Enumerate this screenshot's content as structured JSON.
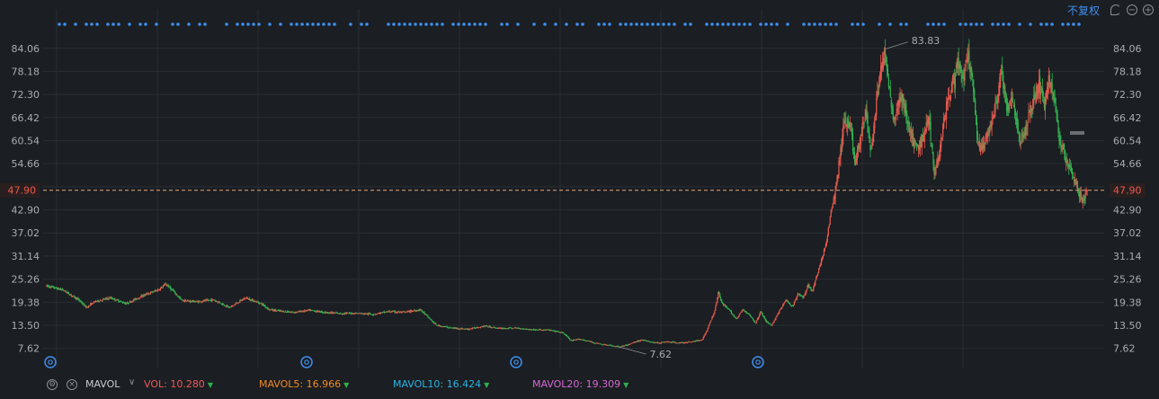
{
  "toolbar": {
    "adjust_mode": "不复权"
  },
  "chart_data": {
    "type": "candlestick",
    "y_ticks": [
      "84.06",
      "78.18",
      "72.30",
      "66.42",
      "60.54",
      "54.66",
      "48.78",
      "42.90",
      "37.02",
      "31.14",
      "25.26",
      "19.38",
      "13.50",
      "7.62"
    ],
    "ylim": [
      2.5,
      89.5
    ],
    "last_price": "47.90",
    "max_label": "83.83",
    "min_label": "7.62",
    "grid": true,
    "price_path": [
      [
        0,
        23.5
      ],
      [
        2,
        22.5
      ],
      [
        4,
        20.0
      ],
      [
        5,
        18.0
      ],
      [
        6,
        19.5
      ],
      [
        8,
        20.5
      ],
      [
        10,
        19.0
      ],
      [
        12,
        21.0
      ],
      [
        14,
        22.5
      ],
      [
        15,
        24.0
      ],
      [
        16,
        22.0
      ],
      [
        17,
        19.8
      ],
      [
        19,
        19.5
      ],
      [
        21,
        20.0
      ],
      [
        23,
        18.0
      ],
      [
        25,
        20.5
      ],
      [
        27,
        19.0
      ],
      [
        28,
        17.5
      ],
      [
        29,
        17.2
      ],
      [
        31,
        16.8
      ],
      [
        33,
        17.3
      ],
      [
        35,
        16.8
      ],
      [
        37,
        16.5
      ],
      [
        39,
        16.6
      ],
      [
        41,
        16.3
      ],
      [
        43,
        17.0
      ],
      [
        45,
        16.8
      ],
      [
        47,
        17.5
      ],
      [
        48,
        15.5
      ],
      [
        49,
        13.5
      ],
      [
        51,
        12.8
      ],
      [
        53,
        12.5
      ],
      [
        55,
        13.3
      ],
      [
        57,
        12.7
      ],
      [
        59,
        12.8
      ],
      [
        61,
        12.4
      ],
      [
        63,
        12.3
      ],
      [
        64,
        12.0
      ],
      [
        65,
        11.5
      ],
      [
        66,
        9.5
      ],
      [
        67,
        10.0
      ],
      [
        68,
        9.5
      ],
      [
        69,
        9.0
      ],
      [
        70,
        8.6
      ],
      [
        71,
        8.3
      ],
      [
        72,
        8.0
      ],
      [
        73,
        8.4
      ],
      [
        74,
        9.3
      ],
      [
        75,
        9.8
      ],
      [
        76,
        9.2
      ],
      [
        77,
        9.0
      ],
      [
        78,
        9.3
      ],
      [
        79,
        9.1
      ],
      [
        80,
        9.0
      ],
      [
        81,
        9.3
      ],
      [
        82,
        9.6
      ],
      [
        82.5,
        10.0
      ],
      [
        83,
        12.0
      ],
      [
        83.5,
        14.5
      ],
      [
        84,
        17.0
      ],
      [
        84.5,
        22.0
      ],
      [
        85,
        19.0
      ],
      [
        86,
        17.0
      ],
      [
        86.8,
        15.0
      ],
      [
        87.5,
        17.5
      ],
      [
        88.5,
        16.0
      ],
      [
        89.2,
        14.0
      ],
      [
        89.8,
        17.0
      ],
      [
        90.5,
        14.5
      ],
      [
        91.2,
        13.5
      ],
      [
        92,
        16.5
      ],
      [
        93,
        20.0
      ],
      [
        93.8,
        18.0
      ],
      [
        94.5,
        21.5
      ],
      [
        95.2,
        20.5
      ],
      [
        95.8,
        24.0
      ],
      [
        96.3,
        22.0
      ],
      [
        97,
        27.0
      ],
      [
        97.6,
        31.0
      ],
      [
        98.2,
        36.0
      ],
      [
        98.7,
        43.0
      ],
      [
        99.2,
        47.0
      ],
      [
        99.7,
        55.0
      ],
      [
        100.4,
        66.0
      ],
      [
        101.2,
        64.0
      ],
      [
        101.6,
        55.0
      ],
      [
        102.3,
        60.0
      ],
      [
        103,
        68.0
      ],
      [
        103.7,
        58.0
      ],
      [
        104.2,
        66.0
      ],
      [
        104.8,
        78.0
      ],
      [
        105.4,
        82.0
      ],
      [
        106,
        75.0
      ],
      [
        106.5,
        66.0
      ],
      [
        107,
        69.0
      ],
      [
        107.6,
        72.0
      ],
      [
        108.3,
        65.0
      ],
      [
        109,
        60.0
      ],
      [
        109.6,
        58.0
      ],
      [
        110.3,
        62.0
      ],
      [
        111,
        66.0
      ],
      [
        111.7,
        52.0
      ],
      [
        112.3,
        58.0
      ],
      [
        112.9,
        66.0
      ],
      [
        113.5,
        72.0
      ],
      [
        114.1,
        76.0
      ],
      [
        114.7,
        80.0
      ],
      [
        115.3,
        76.0
      ],
      [
        115.9,
        82.0
      ],
      [
        116.5,
        75.0
      ],
      [
        117.1,
        60.0
      ],
      [
        117.7,
        58.0
      ],
      [
        118.3,
        62.0
      ],
      [
        118.9,
        66.0
      ],
      [
        119.5,
        70.0
      ],
      [
        120.1,
        80.0
      ],
      [
        120.7,
        68.0
      ],
      [
        121.3,
        72.0
      ],
      [
        121.9,
        66.0
      ],
      [
        122.5,
        60.0
      ],
      [
        123.1,
        63.0
      ],
      [
        123.7,
        68.0
      ],
      [
        124.3,
        72.0
      ],
      [
        124.9,
        75.0
      ],
      [
        125.5,
        70.0
      ],
      [
        126.1,
        76.0
      ],
      [
        126.7,
        72.0
      ],
      [
        127.3,
        62.0
      ],
      [
        127.9,
        58.0
      ],
      [
        128.5,
        55.0
      ],
      [
        129.1,
        52.0
      ],
      [
        129.7,
        48.0
      ],
      [
        130.3,
        45.0
      ],
      [
        131,
        47.9
      ]
    ],
    "indicators": {
      "name": "MAVOL",
      "items": [
        {
          "label": "VOL: 10.280",
          "color": "#ef5a5a"
        },
        {
          "label": "MAVOL5: 16.966",
          "color": "#f08a24"
        },
        {
          "label": "MAVOL10: 16.424",
          "color": "#2ab3e6"
        },
        {
          "label": "MAVOL20: 19.309",
          "color": "#d866d8"
        }
      ]
    },
    "colors": {
      "up": "#e85a4f",
      "down": "#32b352",
      "accent": "#3d8ff0",
      "last_price": "#e85a4f",
      "grid": "#2a2e33",
      "tick": "#a8adb3"
    }
  }
}
